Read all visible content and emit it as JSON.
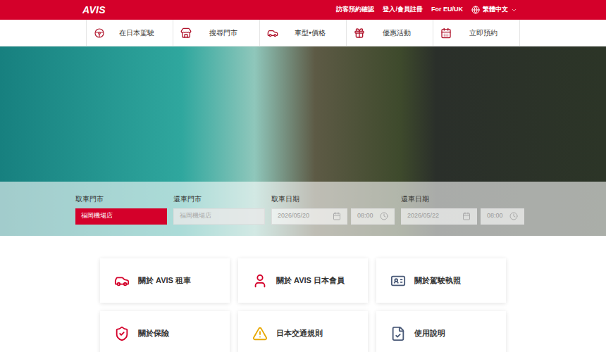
{
  "header": {
    "logo": "AVIS",
    "links": [
      "訪客預約確認",
      "登入/會員註冊",
      "For EU/UK"
    ],
    "language": "繁體中文"
  },
  "nav": [
    {
      "label": "在日本駕駛"
    },
    {
      "label": "搜尋門市"
    },
    {
      "label": "車型•價格"
    },
    {
      "label": "優惠活動"
    },
    {
      "label": "立即預約"
    }
  ],
  "booking": {
    "pickup_store": {
      "label": "取車門市",
      "value": "福岡機場店",
      "disabled": false
    },
    "return_store": {
      "label": "還車門市",
      "value": "福岡機場店",
      "disabled": true
    },
    "pickup_date": {
      "label": "取車日期",
      "date": "2026/05/20",
      "time": "08:00"
    },
    "return_date": {
      "label": "還車日期",
      "date": "2026/05/22",
      "time": "08:00"
    }
  },
  "cards": [
    {
      "label": "關於 AVIS 租車"
    },
    {
      "label": "關於 AVIS 日本會員"
    },
    {
      "label": "關於駕駛執照"
    },
    {
      "label": "關於保險"
    },
    {
      "label": "日本交通規則"
    },
    {
      "label": "使用說明"
    }
  ]
}
